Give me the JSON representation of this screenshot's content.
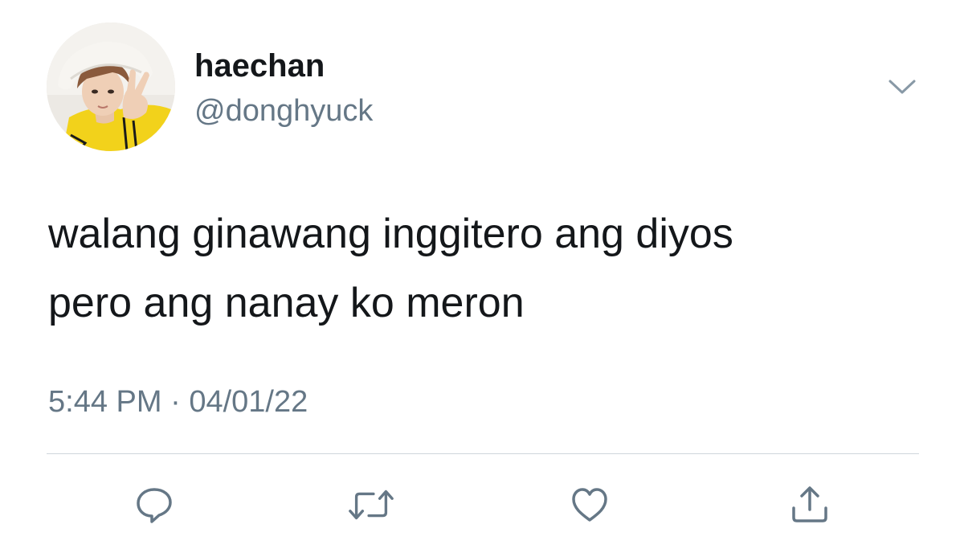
{
  "tweet": {
    "author": {
      "display_name": "haechan",
      "handle": "@donghyuck",
      "avatar_icon": "profile-photo"
    },
    "text_lines": [
      "walang ginawang inggitero ang diyos",
      "pero ang nanay ko meron"
    ],
    "time": "5:44 PM",
    "separator": "·",
    "date": "04/01/22",
    "menu_icon": "chevron-down-icon",
    "actions": [
      {
        "icon": "reply-icon"
      },
      {
        "icon": "retweet-icon"
      },
      {
        "icon": "like-icon"
      },
      {
        "icon": "share-icon"
      }
    ],
    "colors": {
      "text": "#14171a",
      "secondary": "#657786",
      "divider": "#cfd6db"
    }
  }
}
